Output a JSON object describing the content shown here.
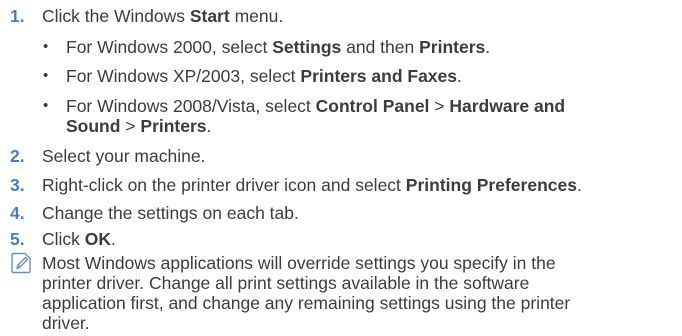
{
  "steps": [
    {
      "num": "1.",
      "pre": "Click the Windows ",
      "bold": "Start",
      "post": " menu.",
      "subs": [
        {
          "bullet": "•",
          "pre": "For Windows 2000, select ",
          "b1": "Settings",
          "mid": " and then ",
          "b2": "Printers",
          "post": "."
        },
        {
          "bullet": "•",
          "pre": "For Windows XP/2003, select ",
          "b1": "Printers and Faxes",
          "post": "."
        },
        {
          "bullet": "•",
          "pre": "For Windows 2008/Vista, select ",
          "b1": "Control Panel",
          "sep1": " > ",
          "b2": "Hardware and",
          "b2b": "Sound",
          "sep2": " > ",
          "b3": "Printers",
          "post": "."
        }
      ]
    },
    {
      "num": "2.",
      "text": "Select your machine."
    },
    {
      "num": "3.",
      "pre": "Right-click on the printer driver icon and select ",
      "bold": "Printing Preferences",
      "post": "."
    },
    {
      "num": "4.",
      "text": "Change the settings on each tab."
    },
    {
      "num": "5.",
      "pre": "Click ",
      "bold": "OK",
      "post": "."
    }
  ],
  "note": {
    "icon": "note-pencil-icon",
    "lines": [
      "Most Windows applications will override settings you specify in the",
      "printer driver. Change all print settings available in the software",
      "application first, and change any remaining settings using the printer",
      "driver."
    ]
  },
  "colors": {
    "step_number": "#4a7fbf",
    "body_text": "#3c3c3c",
    "icon_stroke": "#6b8fc4"
  }
}
